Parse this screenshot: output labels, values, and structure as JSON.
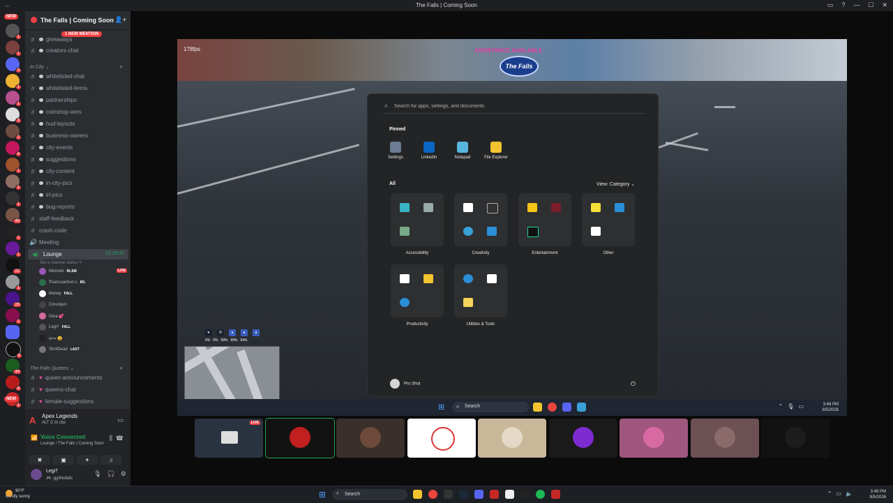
{
  "window": {
    "title": "The Falls | Coming Soon",
    "back": "←",
    "controls": [
      "▭",
      "?",
      "—",
      "☐",
      "✕"
    ]
  },
  "rail": {
    "new_label": "NEW",
    "badges": [
      "1",
      "1",
      "3",
      "1",
      "1",
      "3",
      "2",
      "4",
      "1",
      "1",
      "1",
      "48",
      "1",
      "1",
      "22",
      "1",
      "29",
      "1",
      "8",
      "44",
      "4",
      "1"
    ]
  },
  "server": {
    "name": "The Falls | Coming Soon ⌄",
    "mention": "1 NEW MENTION"
  },
  "channels_top": [
    {
      "name": "giveaways"
    },
    {
      "name": "creators-chat"
    }
  ],
  "category_city": "In City",
  "channels_city": [
    {
      "name": "whitelisted-chat"
    },
    {
      "name": "whitelisted-items"
    },
    {
      "name": "partnerships"
    },
    {
      "name": "coinshop-wins"
    },
    {
      "name": "hud-layouts"
    },
    {
      "name": "business-owners"
    },
    {
      "name": "city-events"
    },
    {
      "name": "suggestions"
    },
    {
      "name": "city-content"
    },
    {
      "name": "in-city-pics"
    },
    {
      "name": "irl-pics"
    },
    {
      "name": "bug-reports"
    },
    {
      "name": "staff-feedback"
    },
    {
      "name": "crash-code"
    },
    {
      "name": "Meeting"
    }
  ],
  "voice": {
    "channel": "Lounge",
    "timer": "10:18:31",
    "status_prompt": "Set a channel status ✎",
    "users": [
      {
        "name": "Meinskii",
        "tag": "RLSM",
        "live": "LIVE",
        "color": "#9b59b6"
      },
      {
        "name": "Ƥнатсхасһнп с",
        "tag": "IRL",
        "color": "#2c6e49"
      },
      {
        "name": "blooey",
        "tag": "FALL",
        "color": "#ffffff"
      },
      {
        "name": "Cmunyun",
        "tag": "",
        "color": "#444"
      },
      {
        "name": "Gina 💕",
        "tag": "",
        "color": "#d36a9e"
      },
      {
        "name": "Legi†",
        "tag": "FALL",
        "color": "#555"
      },
      {
        "name": "w⊶ 😩",
        "tag": "",
        "color": "#222"
      },
      {
        "name": "ShotDead",
        "tag": "LAST",
        "color": "#777"
      }
    ]
  },
  "category_queens": "The Falls Queens",
  "channels_queens": [
    {
      "name": "queen-announcements"
    },
    {
      "name": "queens-chat"
    },
    {
      "name": "female-suggestions"
    }
  ],
  "activity": {
    "game": "Apex Legends",
    "clip": "ALT  C   to clip"
  },
  "voice_connected": {
    "title": "Voice Connected",
    "sub": "Lounge / The Falls | Coming Soon"
  },
  "userbar": {
    "name": "Legi†",
    "status": "🎮 .gg/thefalls"
  },
  "stream": {
    "fps": "178fps",
    "banner": "ASSISTANCE AVAILABLE",
    "logo": "The Falls",
    "hud_pcts": [
      "0%",
      "0%",
      "99%",
      "99%",
      "94%"
    ]
  },
  "start_menu": {
    "search_placeholder": "Search for apps, settings, and documents",
    "pinned_label": "Pinned",
    "pinned": [
      "Settings",
      "LinkedIn",
      "Notepad",
      "File Explorer"
    ],
    "all_label": "All",
    "view": "View: Category ⌄",
    "folders": [
      "Accessibility",
      "Creativity",
      "Entertainment",
      "Other",
      "Productivity",
      "Utilities & Tools"
    ],
    "user": "Pro Shot",
    "power": "⏻"
  },
  "game_taskbar": {
    "search": "Search",
    "time": "3:48 PM",
    "date": "8/5/2026"
  },
  "os_taskbar": {
    "weather_temp": "90°F",
    "weather_desc": "Mostly sunny",
    "search": "Search",
    "time": "3:48 PM",
    "date": "8/5/2026"
  },
  "colors": {
    "accent_red": "#f23f43",
    "voice_green": "#23a559",
    "sidebar": "#2b2d31",
    "rail": "#1e1f22"
  }
}
